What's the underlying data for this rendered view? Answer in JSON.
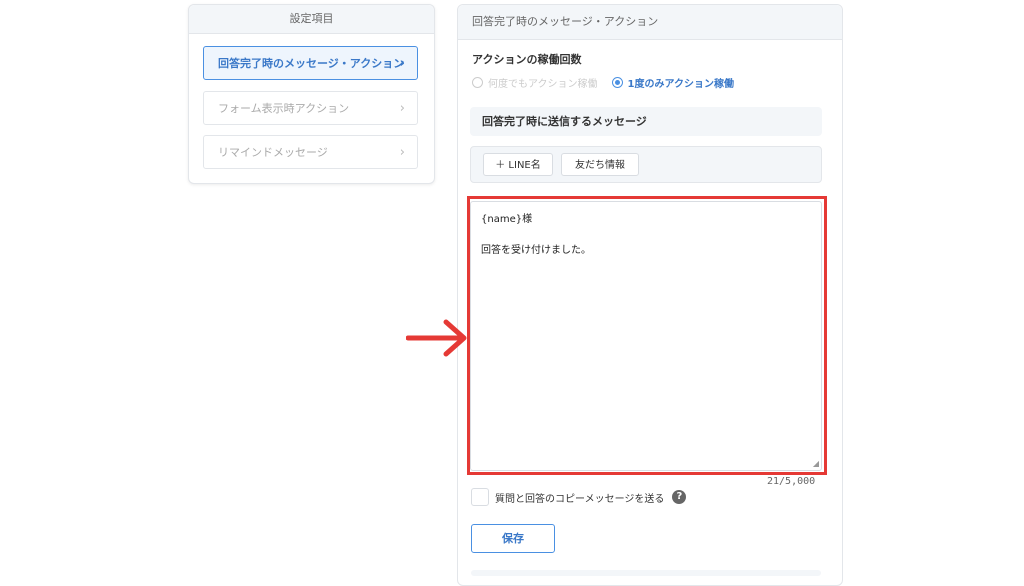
{
  "left_card": {
    "title": "設定項目",
    "items": [
      {
        "label": "回答完了時のメッセージ・アクション",
        "active": true
      },
      {
        "label": "フォーム表示時アクション",
        "active": false
      },
      {
        "label": "リマインドメッセージ",
        "active": false
      }
    ]
  },
  "right_panel": {
    "title": "回答完了時のメッセージ・アクション",
    "action_count_label": "アクションの稼働回数",
    "options": [
      {
        "label": "何度でもアクション稼働",
        "selected": false
      },
      {
        "label": "1度のみアクション稼働",
        "selected": true
      }
    ],
    "message_section_label": "回答完了時に送信するメッセージ",
    "insert_buttons": {
      "line_name": "＋ LINE名",
      "friend_info": "友だち情報"
    },
    "message_lines": [
      "{name}様",
      "回答を受け付けました。"
    ],
    "char_counter": "21/5,000",
    "copy_checkbox_label": "質問と回答のコピーメッセージを送る",
    "help_symbol": "?",
    "save_label": "保存"
  },
  "colors": {
    "accent": "#4a90e2",
    "annotation": "#e53935",
    "panel_header_bg": "#f3f6f9"
  }
}
